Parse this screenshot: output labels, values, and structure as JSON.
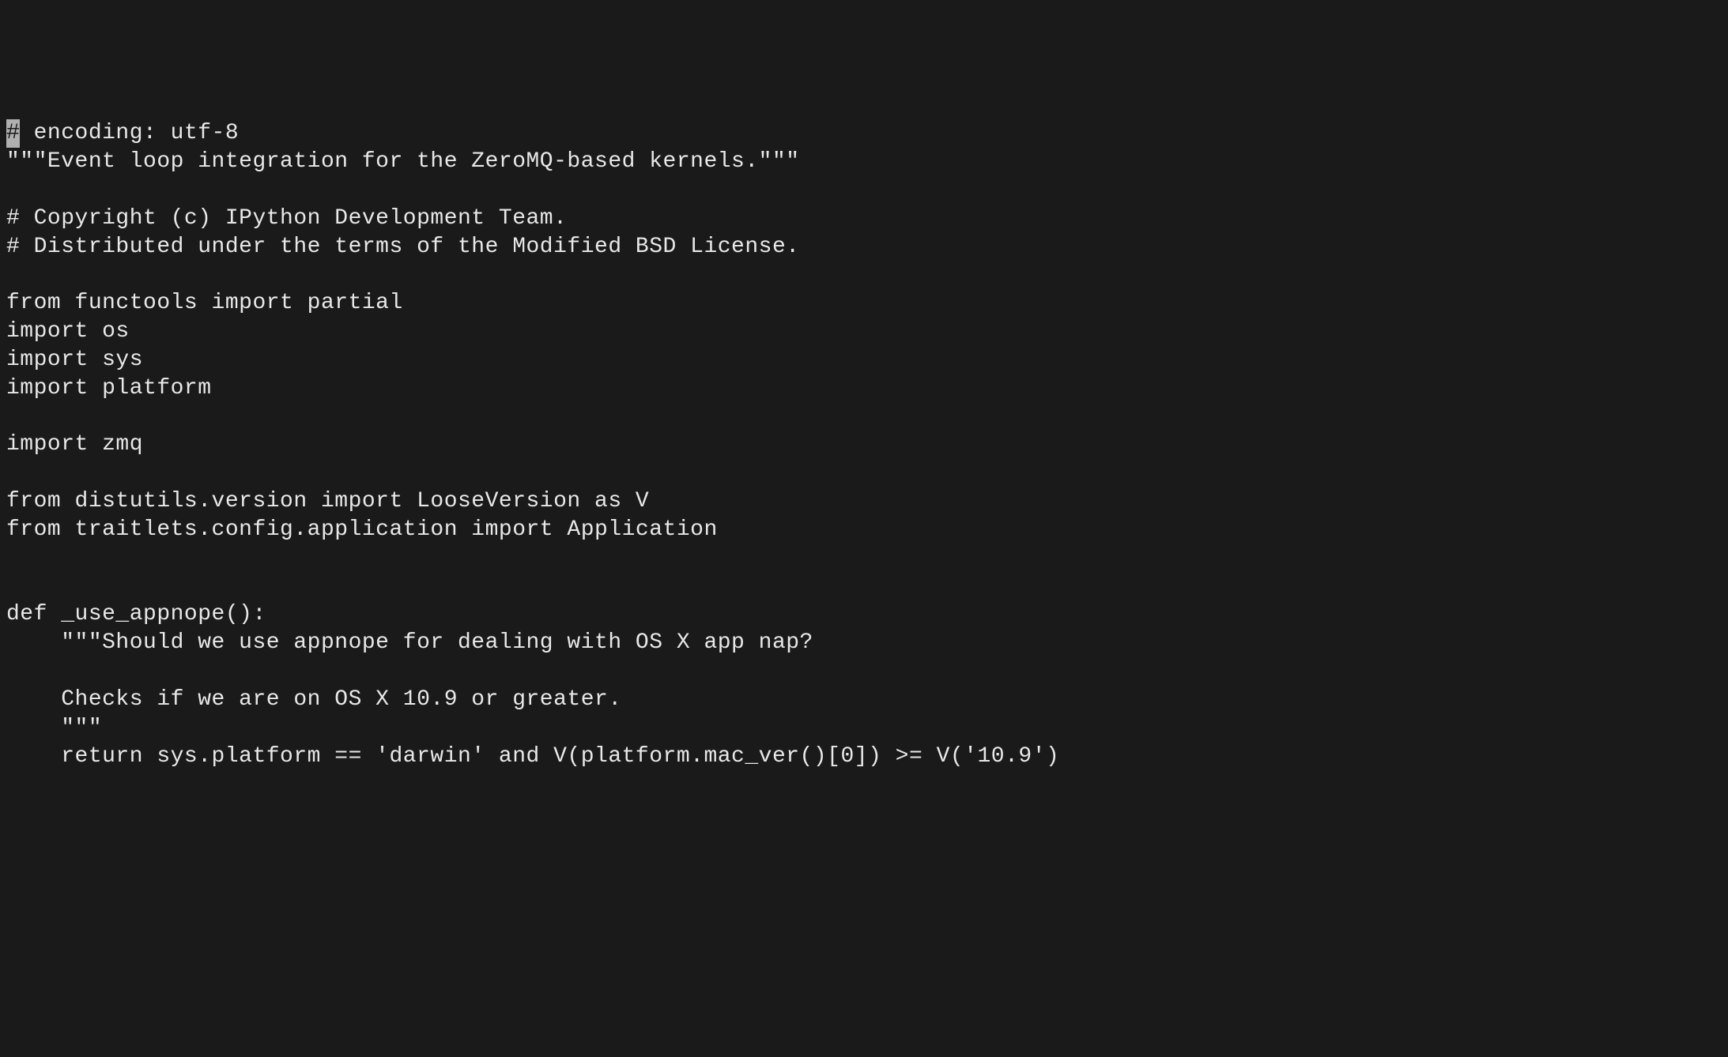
{
  "code": {
    "cursor_char": "#",
    "line1_rest": " encoding: utf-8",
    "line2": "\"\"\"Event loop integration for the ZeroMQ-based kernels.\"\"\"",
    "line3": "",
    "line4": "# Copyright (c) IPython Development Team.",
    "line5": "# Distributed under the terms of the Modified BSD License.",
    "line6": "",
    "line7": "from functools import partial",
    "line8": "import os",
    "line9": "import sys",
    "line10": "import platform",
    "line11": "",
    "line12": "import zmq",
    "line13": "",
    "line14": "from distutils.version import LooseVersion as V",
    "line15": "from traitlets.config.application import Application",
    "line16": "",
    "line17": "",
    "line18": "def _use_appnope():",
    "line19": "    \"\"\"Should we use appnope for dealing with OS X app nap?",
    "line20": "",
    "line21": "    Checks if we are on OS X 10.9 or greater.",
    "line22": "    \"\"\"",
    "line23": "    return sys.platform == 'darwin' and V(platform.mac_ver()[0]) >= V('10.9')"
  }
}
